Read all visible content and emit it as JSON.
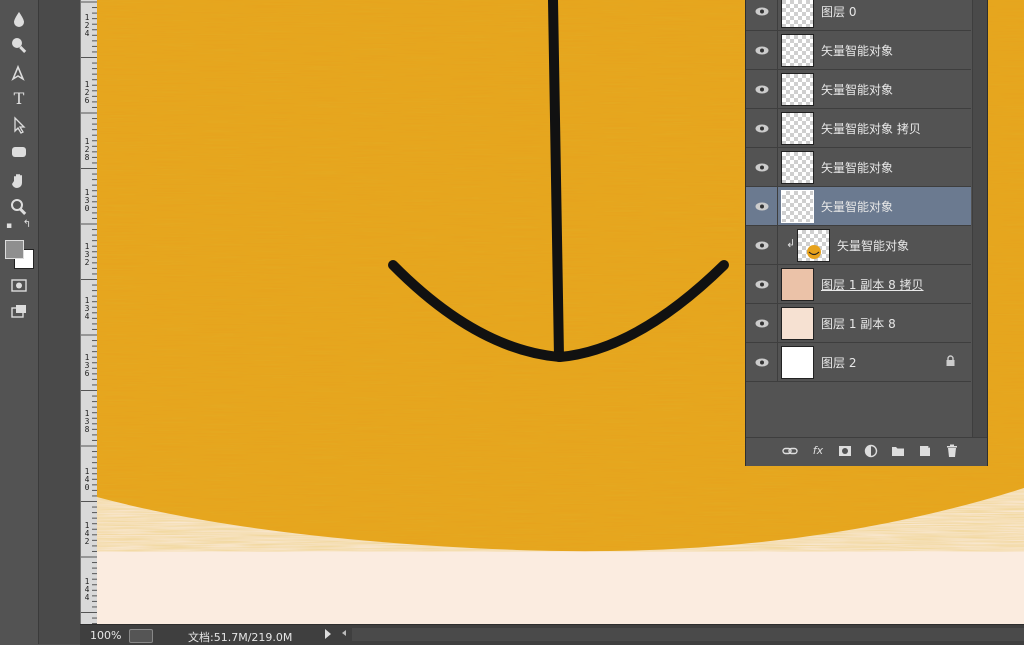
{
  "toolbar": {
    "tools": [
      "drop-icon",
      "zoom-icon",
      "pen-icon",
      "type-icon",
      "path-select-icon",
      "rectangle-icon",
      "hand-icon",
      "zoom-tool-icon",
      "swap-colors-icon",
      "foreground-color",
      "quick-mask-icon",
      "screen-mode-icon"
    ],
    "colors": {
      "foreground": "#8f8f8f",
      "background": "#ffffff"
    }
  },
  "ruler": {
    "labels": [
      "1 2 4",
      "1 2 6",
      "1 2 8",
      "1 3 0",
      "1 3 2",
      "1 3 4",
      "1 3 6",
      "1 3 8",
      "1 4 0",
      "1 4 2",
      "1 4 4"
    ]
  },
  "canvas": {
    "colors": {
      "wood": "#e7a21c",
      "cream": "#fbece0",
      "stroke": "#111111"
    }
  },
  "layers": {
    "items": [
      {
        "name": "图层 0",
        "thumb": "transparent",
        "selected": false,
        "clipped": false,
        "locked": false,
        "underline": false
      },
      {
        "name": "矢量智能对象",
        "thumb": "transparent",
        "selected": false,
        "clipped": false,
        "locked": false,
        "underline": false
      },
      {
        "name": "矢量智能对象",
        "thumb": "transparent",
        "selected": false,
        "clipped": false,
        "locked": false,
        "underline": false
      },
      {
        "name": "矢量智能对象 拷贝",
        "thumb": "transparent",
        "selected": false,
        "clipped": false,
        "locked": false,
        "underline": false
      },
      {
        "name": "矢量智能对象",
        "thumb": "transparent",
        "selected": false,
        "clipped": false,
        "locked": false,
        "underline": false
      },
      {
        "name": "矢量智能对象",
        "thumb": "transparent",
        "selected": true,
        "clipped": false,
        "locked": false,
        "underline": false
      },
      {
        "name": "矢量智能对象",
        "thumb": "transparent",
        "selected": false,
        "clipped": true,
        "locked": false,
        "underline": false
      },
      {
        "name": "图层 1 副本 8 拷贝",
        "thumb": "salmon",
        "selected": false,
        "clipped": false,
        "locked": false,
        "underline": true
      },
      {
        "name": "图层 1 副本 8",
        "thumb": "peach",
        "selected": false,
        "clipped": false,
        "locked": false,
        "underline": false
      },
      {
        "name": "图层 2",
        "thumb": "white",
        "selected": false,
        "clipped": false,
        "locked": true,
        "underline": false
      }
    ],
    "footer": {
      "link": "link-icon",
      "fx": "fx",
      "mask": "mask-icon",
      "adjust": "adjustment-icon",
      "group": "folder-icon",
      "new": "new-layer-icon",
      "delete": "trash-icon"
    }
  },
  "status": {
    "zoom": "100%",
    "doc": "文档:51.7M/219.0M"
  }
}
